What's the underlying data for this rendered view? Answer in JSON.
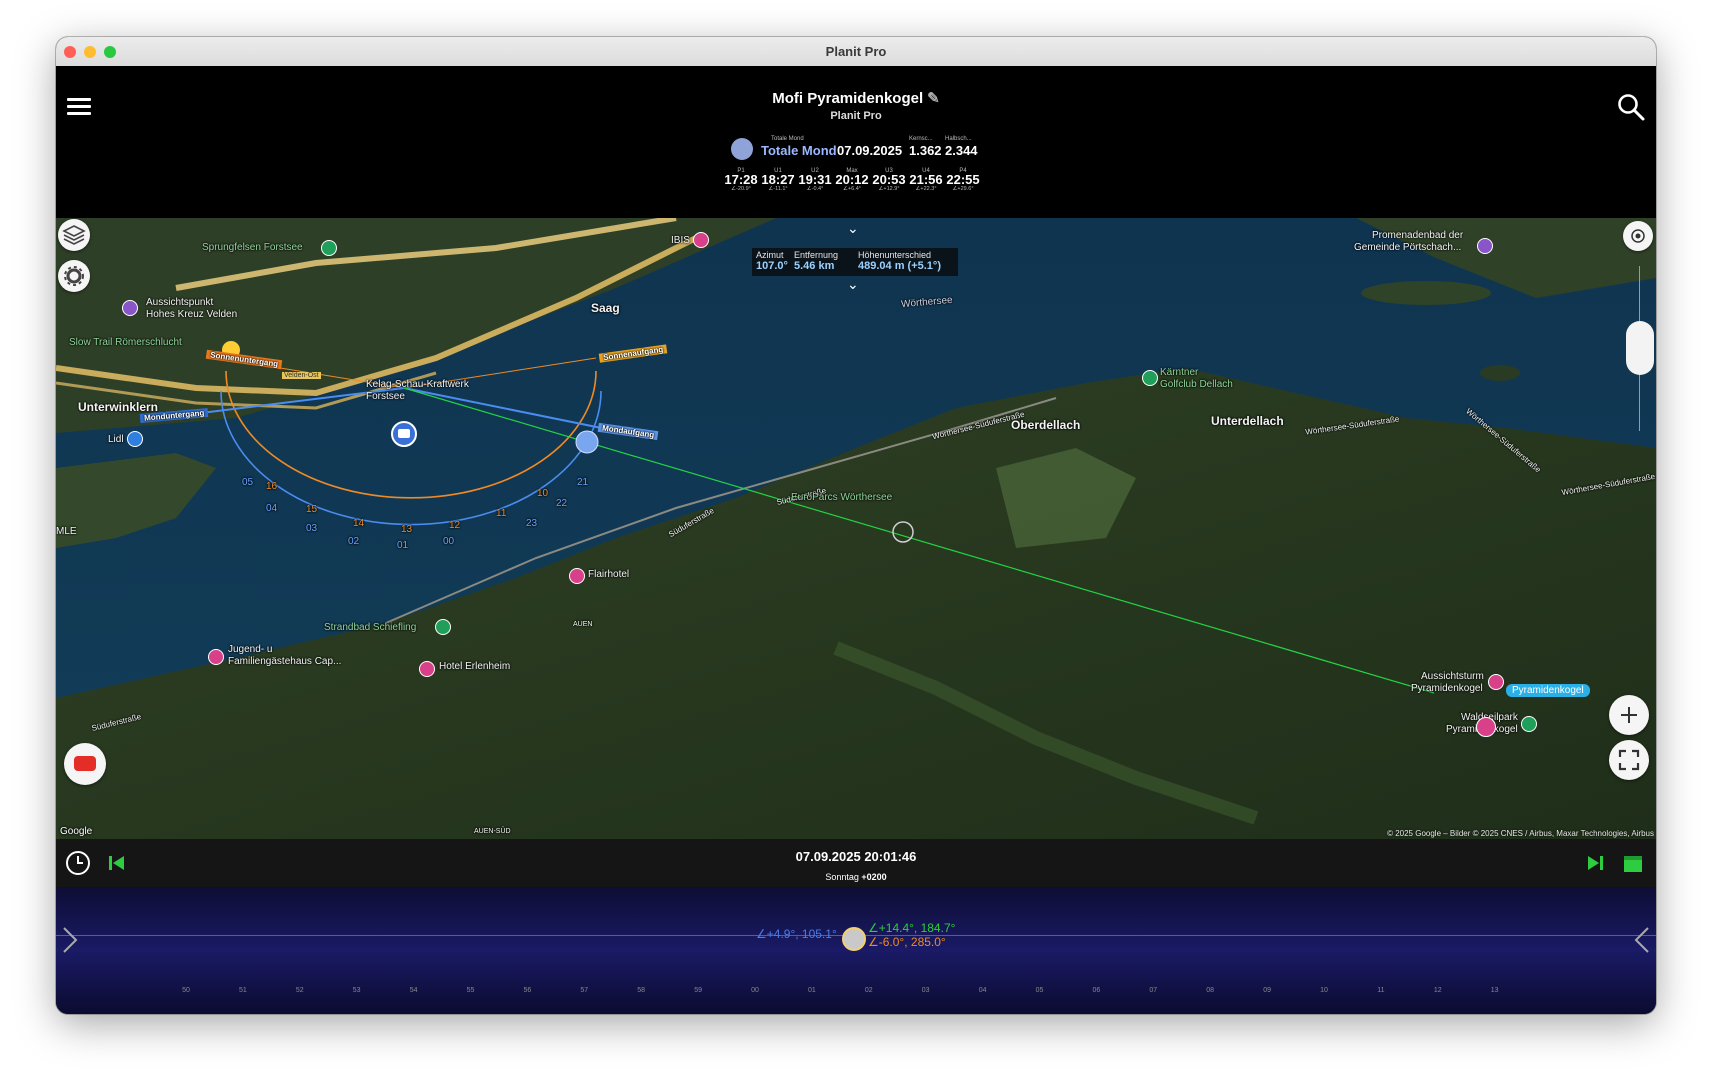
{
  "window": {
    "title": "Planit Pro"
  },
  "header": {
    "title": "Mofi Pyramidenkogel",
    "subtitle": "Planit Pro",
    "eclipse": {
      "type_small": "Totale Mond",
      "type": "Totale Mond",
      "date": "07.09.2025",
      "magnitude_label": "Kernsc...",
      "magnitude": "1.362",
      "half_label": "Halbsch...",
      "half": "2.344"
    },
    "contacts": [
      {
        "label": "P1",
        "time": "17:28",
        "alt": "∠-20.9°"
      },
      {
        "label": "U1",
        "time": "18:27",
        "alt": "∠-11.1°"
      },
      {
        "label": "U2",
        "time": "19:31",
        "alt": "∠-0.4°"
      },
      {
        "label": "Max",
        "time": "20:12",
        "alt": "∠+6.4°"
      },
      {
        "label": "U3",
        "time": "20:53",
        "alt": "∠+12.9°"
      },
      {
        "label": "U4",
        "time": "21:56",
        "alt": "∠+22.3°"
      },
      {
        "label": "P4",
        "time": "22:55",
        "alt": "∠+29.6°"
      }
    ]
  },
  "infobox": {
    "azimut_label": "Azimut",
    "azimut": "107.0°",
    "distance_label": "Entfernung",
    "distance": "5.46 km",
    "height_label": "Höhenunterschied",
    "height": "489.04 m (+5.1°)"
  },
  "map": {
    "labels": {
      "sprungfelsen": "Sprungfelsen Forstsee",
      "aussichtspunkt": "Aussichtspunkt",
      "hohes_kreuz": "Hohes Kreuz Velden",
      "slow_trail": "Slow Trail Römerschlucht",
      "unterwinklern": "Unterwinklern",
      "lidl": "Lidl",
      "saag": "Saag",
      "ibis": "IBIS",
      "kelag": "Kelag-Schau-Kraftwerk",
      "forstsee": "Forstsee",
      "velden_ost": "Velden-Ost",
      "woerthersee": "Wörthersee",
      "promenadenbad1": "Promenadenbad der",
      "promenadenbad2": "Gemeinde Pörtschach...",
      "kaerntner": "Kärntner",
      "golfclub": "Golfclub Dellach",
      "oberdellach": "Oberdellach",
      "unterdellach": "Unterdellach",
      "woerthersee_sued1": "Wörthersee-Süduferstraße",
      "woerthersee_sued2": "Wörthersee-Süduferstraße",
      "woerthersee_sued3": "Wörthersee-Süduferstraße",
      "woerthersee_sued4": "Wörthersee-Süduferstraße",
      "suduferstrasse1": "Süduferstraße",
      "suduferstrasse2": "Süduferstraße",
      "suduferstrasse3": "Süduferstraße",
      "europarcs": "EuroParcs Wörthersee",
      "flairhotel": "Flairhotel",
      "strandbad": "Strandbad Schiefling",
      "jugend1": "Jugend- u",
      "jugend2": "Familiengästehaus Cap...",
      "hotel_erlenheim": "Hotel Erlenheim",
      "auen": "AUEN",
      "auen_sued": "AUEN-SÜD",
      "mle": "MLE",
      "aussichtsturm1": "Aussichtsturm",
      "aussichtsturm2": "Pyramidenkogel",
      "pyramidenkogel_tag": "Pyramidenkogel",
      "waldseilpark1": "Waldseilpark",
      "waldseilpark2": "Pyramidenkogel",
      "google": "Google",
      "sonnenuntergang": "Sonnenuntergang",
      "sonnenaufgang": "Sonnenaufgang",
      "monduntergang": "Monduntergang",
      "mondaufgang": "Mondaufgang"
    },
    "moon_hours": [
      "05",
      "04",
      "03",
      "02",
      "01",
      "00",
      "23",
      "22",
      "21"
    ],
    "sun_hours": [
      "16",
      "15",
      "14",
      "13",
      "12",
      "11",
      "10"
    ],
    "copyright": "© 2025 Google – Bilder © 2025 CNES / Airbus, Maxar Technologies, Airbus"
  },
  "timebar": {
    "datetime": "07.09.2025 20:01:46",
    "day": "Sonntag",
    "offset": "+0200"
  },
  "timeline": {
    "ticks": [
      "50",
      "51",
      "52",
      "53",
      "54",
      "55",
      "56",
      "57",
      "58",
      "59",
      "00",
      "01",
      "02",
      "03",
      "04",
      "05",
      "06",
      "07",
      "08",
      "09",
      "10",
      "11",
      "12",
      "13"
    ],
    "moon_readout": "∠+4.9°, 105.1°",
    "sun_readout_alt": "∠+14.4°, 184.7°",
    "sun_readout": "∠-6.0°, 285.0°"
  },
  "colors": {
    "sun": "#f08a24",
    "moon": "#4a8cf0",
    "line": "#22d444",
    "accent_green": "#2ecc40"
  }
}
